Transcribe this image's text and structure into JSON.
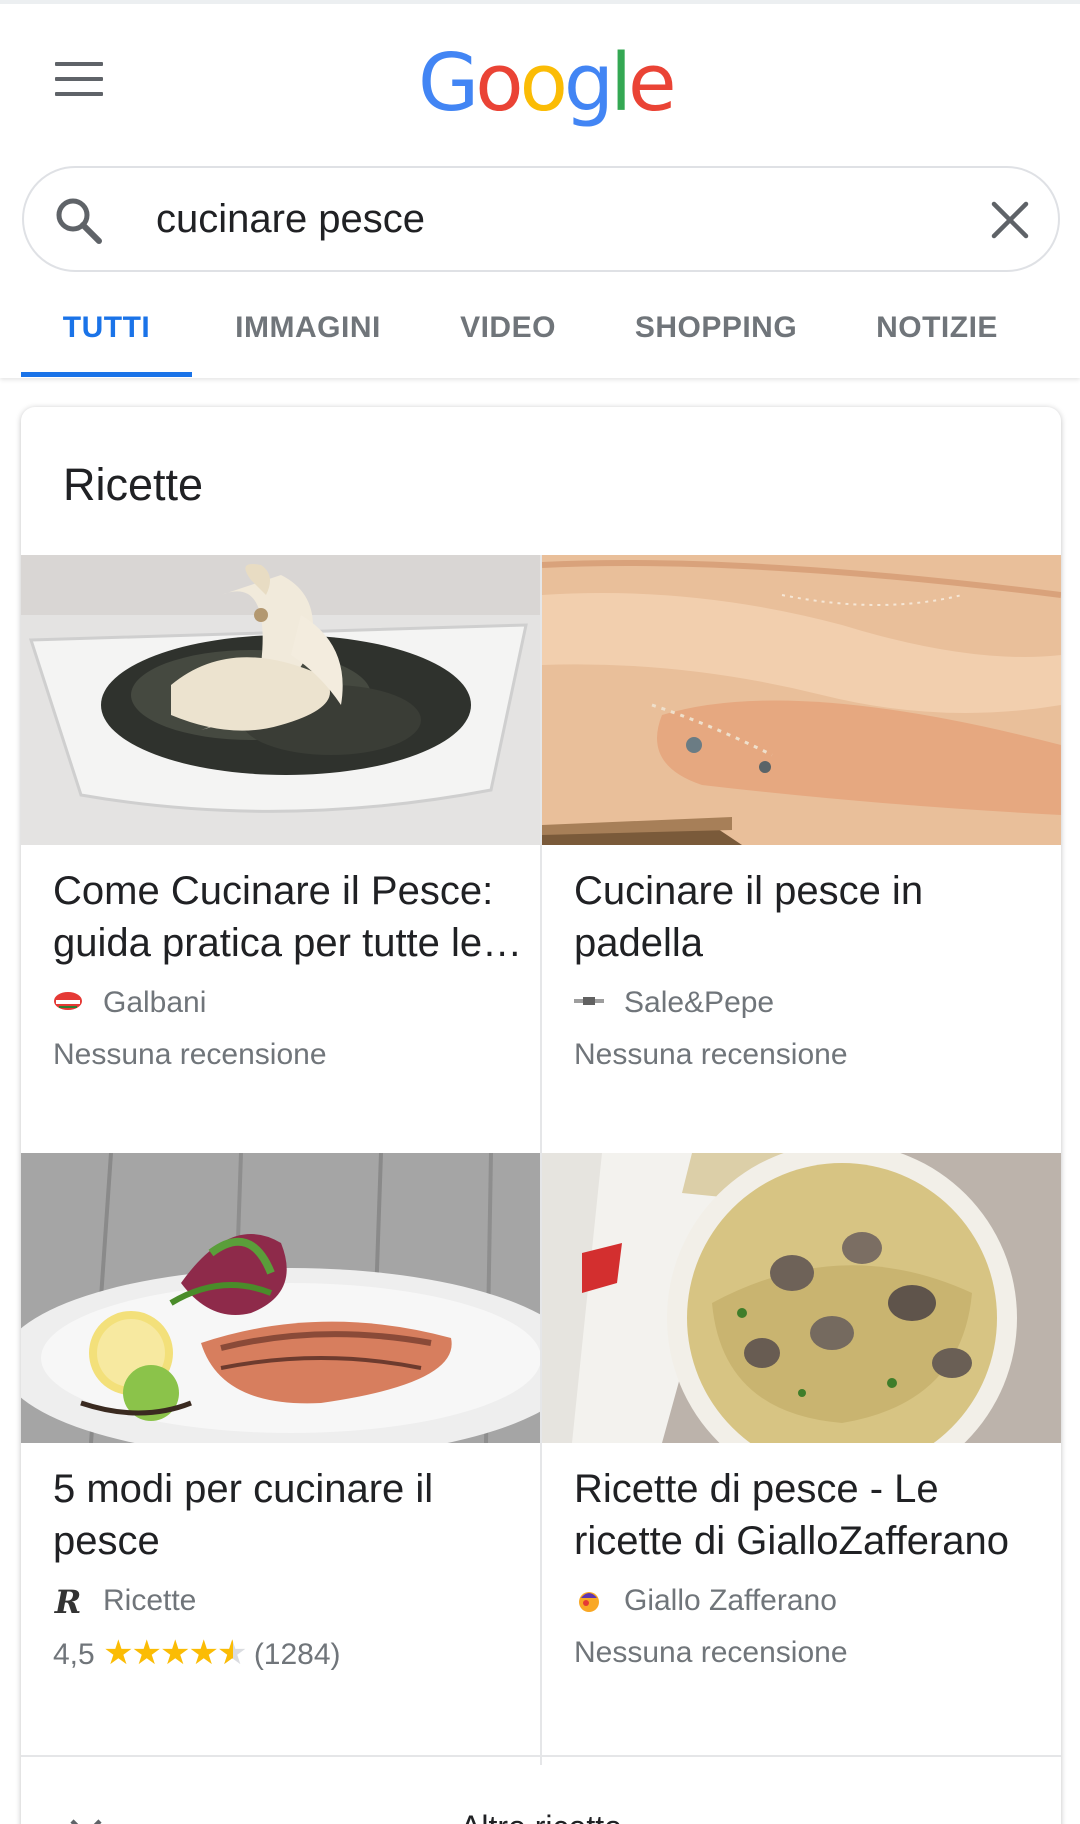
{
  "header": {
    "menu_icon": "hamburger-menu-icon",
    "logo": {
      "letters": [
        "G",
        "o",
        "o",
        "g",
        "l",
        "e"
      ],
      "colors": [
        "#4285F4",
        "#EA4335",
        "#FBBC05",
        "#4285F4",
        "#34A853",
        "#EA4335"
      ]
    }
  },
  "search": {
    "query": "cucinare pesce",
    "search_icon": "magnifier-icon",
    "clear_icon": "close-icon"
  },
  "tabs": [
    {
      "label": "TUTTI",
      "active": true
    },
    {
      "label": "IMMAGINI",
      "active": false
    },
    {
      "label": "VIDEO",
      "active": false
    },
    {
      "label": "SHOPPING",
      "active": false
    },
    {
      "label": "NOTIZIE",
      "active": false
    }
  ],
  "accent_color": "#1a73e8",
  "card": {
    "title": "Ricette",
    "recipes": [
      {
        "title_line1": "Come Cucinare il Pesce:",
        "title_line2": "guida pratica per tutte le…",
        "source": "Galbani",
        "review": "Nessuna recensione"
      },
      {
        "title_line1": "Cucinare il pesce in",
        "title_line2": "padella",
        "source": "Sale&Pepe",
        "review": "Nessuna recensione"
      },
      {
        "title_line1": "5 modi per cucinare il",
        "title_line2": "pesce",
        "source": "Ricette",
        "rating": "4,5",
        "rating_value": 4.5,
        "rating_count": "(1284)"
      },
      {
        "title_line1": "Ricette di pesce - Le",
        "title_line2": "ricette di GialloZafferano",
        "source": "Giallo Zafferano",
        "review": "Nessuna recensione"
      }
    ],
    "more_label": "Altre ricette",
    "more_icon": "chevron-down-icon"
  }
}
